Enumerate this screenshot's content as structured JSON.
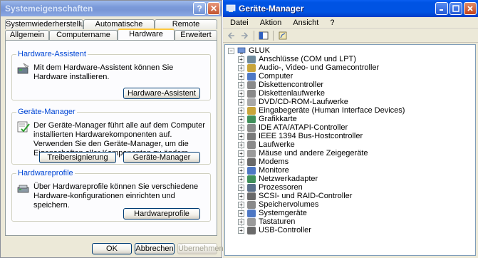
{
  "sysprops": {
    "title": "Systemeigenschaften",
    "tabs_top": [
      "Systemwiederherstellung",
      "Automatische Updates",
      "Remote"
    ],
    "tabs_bottom": [
      "Allgemein",
      "Computername",
      "Hardware",
      "Erweitert"
    ],
    "active_tab": "Hardware",
    "groups": {
      "assistant": {
        "title": "Hardware-Assistent",
        "text": "Mit dem Hardware-Assistent können Sie Hardware installieren.",
        "button": "Hardware-Assistent"
      },
      "devmgr": {
        "title": "Geräte-Manager",
        "text": "Der Geräte-Manager führt alle auf dem Computer installierten Hardwarekomponenten auf. Verwenden Sie den Geräte-Manager, um die Eigenschaften aller Komponenten zu ändern.",
        "button1": "Treibersignierung",
        "button2": "Geräte-Manager"
      },
      "profiles": {
        "title": "Hardwareprofile",
        "text": "Über Hardwareprofile können Sie verschiedene Hardware-konfigurationen einrichten und speichern.",
        "button": "Hardwareprofile"
      }
    },
    "footer": {
      "ok": "OK",
      "cancel": "Abbrechen",
      "apply": "Übernehmen"
    },
    "title_help": "?",
    "title_close": "✕"
  },
  "devmgr": {
    "title": "Geräte-Manager",
    "menu": [
      "Datei",
      "Aktion",
      "Ansicht",
      "?"
    ],
    "root": "GLUK",
    "items": [
      {
        "label": "Anschlüsse (COM und LPT)",
        "icon": "port-icon",
        "color": "#6e8a9c"
      },
      {
        "label": "Audio-, Video- und Gamecontroller",
        "icon": "speaker-icon",
        "color": "#c9a53a"
      },
      {
        "label": "Computer",
        "icon": "computer-icon",
        "color": "#4d77c4"
      },
      {
        "label": "Diskettencontroller",
        "icon": "disk-controller-icon",
        "color": "#8a8a8a"
      },
      {
        "label": "Diskettenlaufwerke",
        "icon": "floppy-icon",
        "color": "#8a8a8a"
      },
      {
        "label": "DVD/CD-ROM-Laufwerke",
        "icon": "cdrom-icon",
        "color": "#a8a8a8"
      },
      {
        "label": "Eingabegeräte (Human Interface Devices)",
        "icon": "hid-icon",
        "color": "#c9a53a"
      },
      {
        "label": "Grafikkarte",
        "icon": "display-adapter-icon",
        "color": "#3f8f5a"
      },
      {
        "label": "IDE ATA/ATAPI-Controller",
        "icon": "ide-icon",
        "color": "#8a8a8a"
      },
      {
        "label": "IEEE 1394 Bus-Hostcontroller",
        "icon": "firewire-icon",
        "color": "#7a7a7a"
      },
      {
        "label": "Laufwerke",
        "icon": "drive-icon",
        "color": "#8a8a8a"
      },
      {
        "label": "Mäuse und andere Zeigegeräte",
        "icon": "mouse-icon",
        "color": "#9a9a9a"
      },
      {
        "label": "Modems",
        "icon": "modem-icon",
        "color": "#6a6a6a"
      },
      {
        "label": "Monitore",
        "icon": "monitor-icon",
        "color": "#4d77c4"
      },
      {
        "label": "Netzwerkadapter",
        "icon": "network-icon",
        "color": "#3f8f5a"
      },
      {
        "label": "Prozessoren",
        "icon": "cpu-icon",
        "color": "#5a6f8a"
      },
      {
        "label": "SCSI- und RAID-Controller",
        "icon": "scsi-icon",
        "color": "#6a6a6a"
      },
      {
        "label": "Speichervolumes",
        "icon": "volume-icon",
        "color": "#8a8a8a"
      },
      {
        "label": "Systemgeräte",
        "icon": "system-devices-icon",
        "color": "#4d77c4"
      },
      {
        "label": "Tastaturen",
        "icon": "keyboard-icon",
        "color": "#9a9a9a"
      },
      {
        "label": "USB-Controller",
        "icon": "usb-icon",
        "color": "#6a6a6a"
      }
    ]
  }
}
